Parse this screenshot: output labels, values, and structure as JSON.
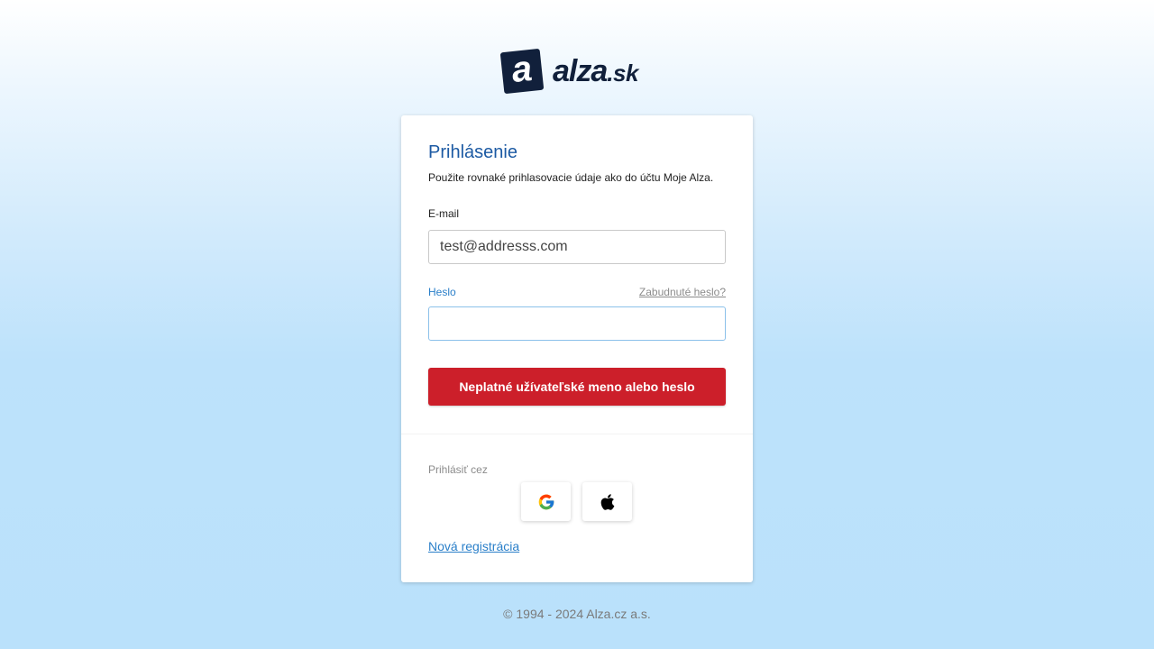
{
  "brand": {
    "logo_mark": "a",
    "logo_name": "alza",
    "logo_tld": ".sk",
    "color": "#11203b"
  },
  "login": {
    "title": "Prihlásenie",
    "subtitle": "Použite rovnaké prihlasovacie údaje ako do účtu Moje Alza.",
    "email_label": "E-mail",
    "email_value": "test@addresss.com",
    "password_label": "Heslo",
    "password_value": "",
    "forgot_link": "Zabudnuté heslo?",
    "error_message": "Neplatné užívateľské meno alebo heslo",
    "error_color": "#cc1f2a",
    "signin_via_label": "Prihlásiť cez",
    "social_icons": [
      "google-icon",
      "apple-icon"
    ],
    "register_link": "Nová registrácia"
  },
  "footer": {
    "copyright": "© 1994 - 2024 Alza.cz a.s."
  },
  "colors": {
    "accent": "#1c5aa3",
    "link": "#2a7fc9"
  }
}
